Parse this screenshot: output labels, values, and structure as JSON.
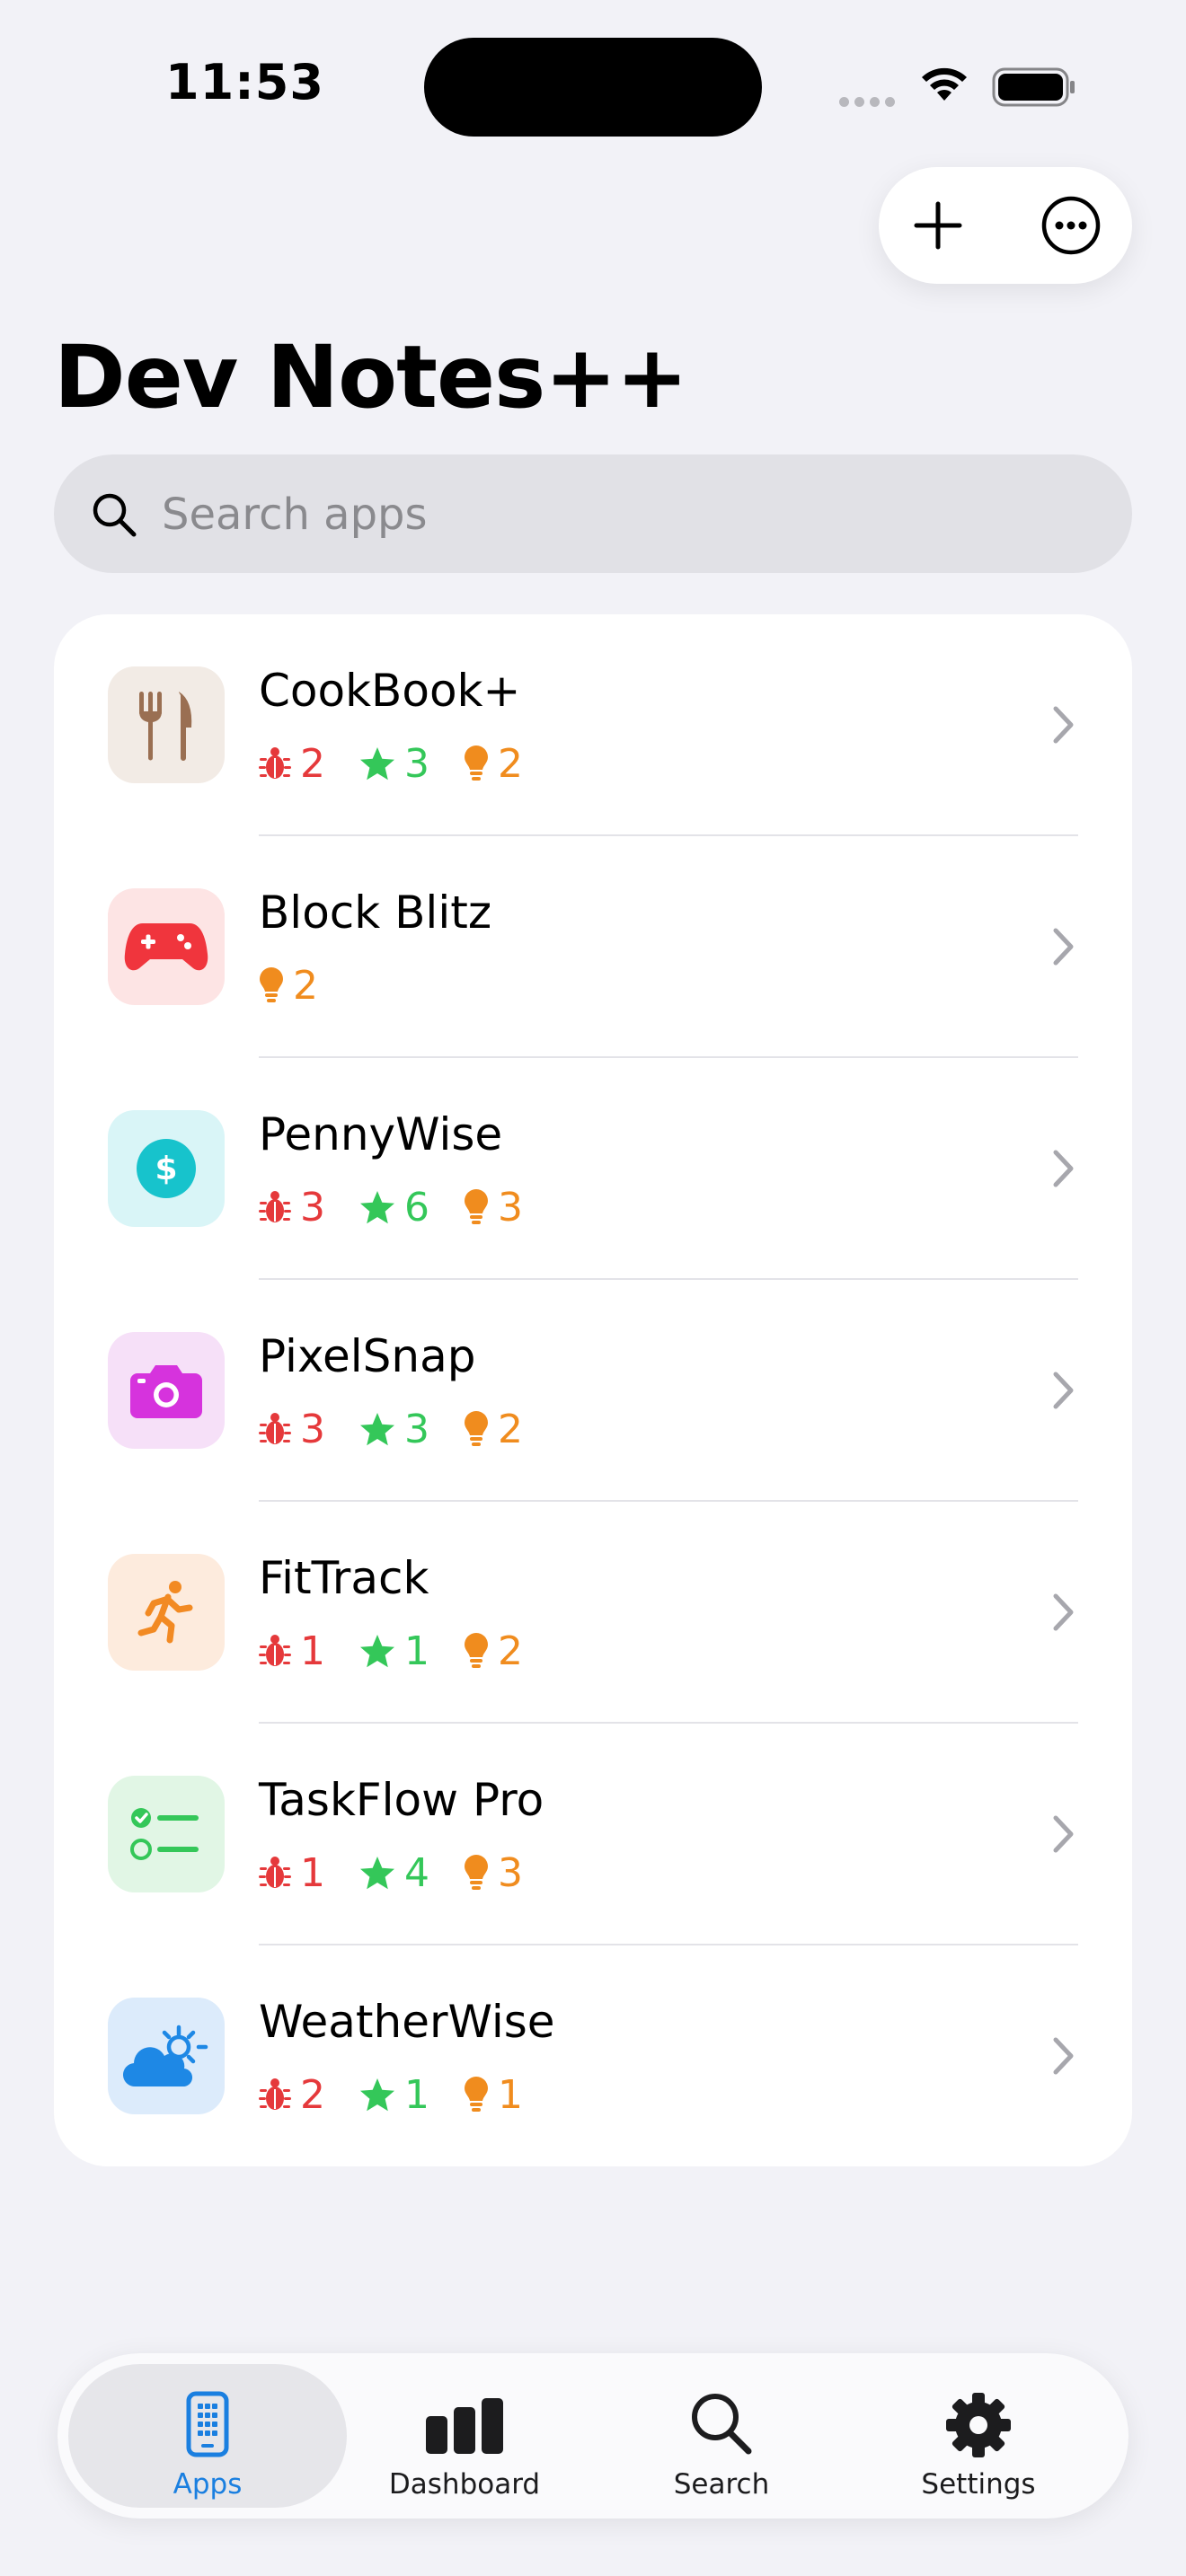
{
  "status_bar": {
    "time": "11:53"
  },
  "header": {
    "title": "Dev Notes++"
  },
  "search": {
    "placeholder": "Search apps",
    "value": ""
  },
  "colors": {
    "bug": "#e5393b",
    "star": "#34c759",
    "idea": "#f08c1e",
    "accent": "#1a7fe0"
  },
  "apps": [
    {
      "name": "CookBook+",
      "icon": "fork-knife-icon",
      "bugs": "2",
      "stars": "3",
      "ideas": "2"
    },
    {
      "name": "Block Blitz",
      "icon": "gamepad-icon",
      "ideas": "2"
    },
    {
      "name": "PennyWise",
      "icon": "dollar-icon",
      "bugs": "3",
      "stars": "6",
      "ideas": "3"
    },
    {
      "name": "PixelSnap",
      "icon": "camera-icon",
      "bugs": "3",
      "stars": "3",
      "ideas": "2"
    },
    {
      "name": "FitTrack",
      "icon": "running-figure-icon",
      "bugs": "1",
      "stars": "1",
      "ideas": "2"
    },
    {
      "name": "TaskFlow Pro",
      "icon": "checklist-icon",
      "bugs": "1",
      "stars": "4",
      "ideas": "3"
    },
    {
      "name": "WeatherWise",
      "icon": "cloud-sun-icon",
      "bugs": "2",
      "stars": "1",
      "ideas": "1"
    }
  ],
  "tabs": [
    {
      "label": "Apps",
      "icon": "phone-icon",
      "active": true
    },
    {
      "label": "Dashboard",
      "icon": "bar-chart-icon",
      "active": false
    },
    {
      "label": "Search",
      "icon": "search-icon",
      "active": false
    },
    {
      "label": "Settings",
      "icon": "gear-icon",
      "active": false
    }
  ]
}
